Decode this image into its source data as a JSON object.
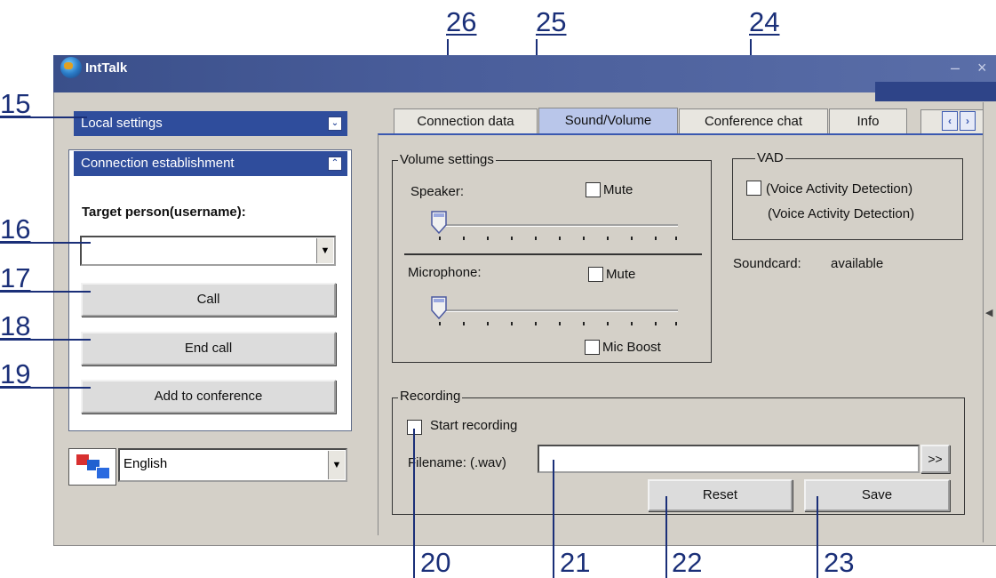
{
  "window": {
    "title": "IntTalk",
    "minimize_glyph": "–",
    "close_glyph": "×"
  },
  "callouts": {
    "c15": "15",
    "c16": "16",
    "c17": "17",
    "c18": "18",
    "c19": "19",
    "c20": "20",
    "c21": "21",
    "c22": "22",
    "c23": "23",
    "c24": "24",
    "c25": "25",
    "c26": "26"
  },
  "left": {
    "local_settings": "Local settings",
    "connection_establishment": "Connection establishment",
    "target_label": "Target person(username):",
    "target_value": "",
    "call": "Call",
    "end_call": "End call",
    "add_conference": "Add to conference",
    "language": "English"
  },
  "tabs": [
    {
      "label": "Connection data"
    },
    {
      "label": "Sound/Volume"
    },
    {
      "label": "Conference chat"
    },
    {
      "label": "Info"
    }
  ],
  "volume": {
    "group": "Volume settings",
    "speaker": "Speaker:",
    "speaker_mute": "Mute",
    "microphone": "Microphone:",
    "mic_mute": "Mute",
    "mic_boost": "Mic Boost"
  },
  "vad": {
    "group": "VAD",
    "line1": "(Voice Activity Detection)",
    "line2": "(Voice Activity Detection)"
  },
  "soundcard": {
    "label": "Soundcard:",
    "value": "available"
  },
  "recording": {
    "group": "Recording",
    "start": "Start recording",
    "filename_label": "Filename: (.wav)",
    "filename_value": "",
    "browse": ">>",
    "reset": "Reset",
    "save": "Save"
  },
  "colors": {
    "callout": "#1a2f78",
    "panel_header": "#2f4d9c",
    "active_tab": "#b9c6ea"
  }
}
